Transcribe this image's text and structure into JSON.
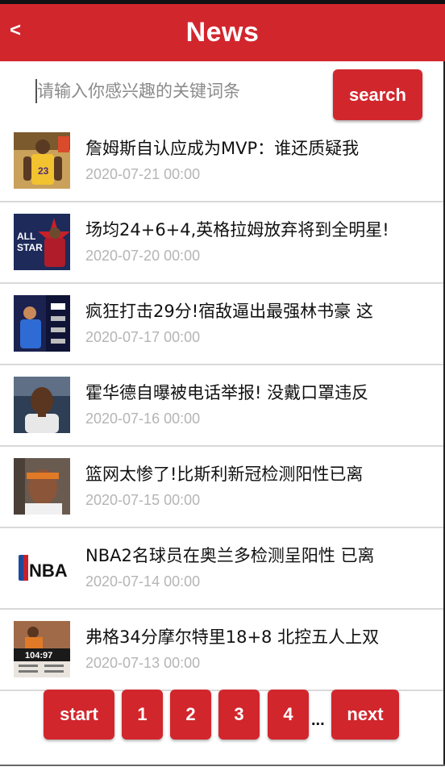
{
  "header": {
    "back_label": "<",
    "title": "News",
    "color": "#d2262d"
  },
  "search": {
    "placeholder": "请输入你感兴趣的关键词条",
    "button_label": "search"
  },
  "news": [
    {
      "title": "詹姆斯自认应成为MVP：谁还质疑我",
      "date": "2020-07-21 00:00",
      "thumb": "lakers-player-photo"
    },
    {
      "title": "场均24+6+4,英格拉姆放弃将到全明星!",
      "date": "2020-07-20 00:00",
      "thumb": "all-star-graphic"
    },
    {
      "title": "疯狂打击29分!宿敌逼出最强林书豪 这",
      "date": "2020-07-17 00:00",
      "thumb": "game-scoreboard-photo"
    },
    {
      "title": "霍华德自曝被电话举报! 没戴口罩违反",
      "date": "2020-07-16 00:00",
      "thumb": "player-portrait-photo"
    },
    {
      "title": "篮网太惨了!比斯利新冠检测阳性已离",
      "date": "2020-07-15 00:00",
      "thumb": "player-headband-photo"
    },
    {
      "title": "NBA2名球员在奥兰多检测呈阳性 已离",
      "date": "2020-07-14 00:00",
      "thumb": "nba-logo"
    },
    {
      "title": "弗格34分摩尔特里18+8 北控五人上双",
      "date": "2020-07-13 00:00",
      "thumb": "cba-scoreboard-photo"
    }
  ],
  "nba_logo_text": "NBA",
  "all_star_text": [
    "ALL",
    "STAR"
  ],
  "score_text": "104:97",
  "pager": {
    "start_label": "start",
    "pages": [
      "1",
      "2",
      "3",
      "4"
    ],
    "ellipsis": "...",
    "next_label": "next"
  }
}
